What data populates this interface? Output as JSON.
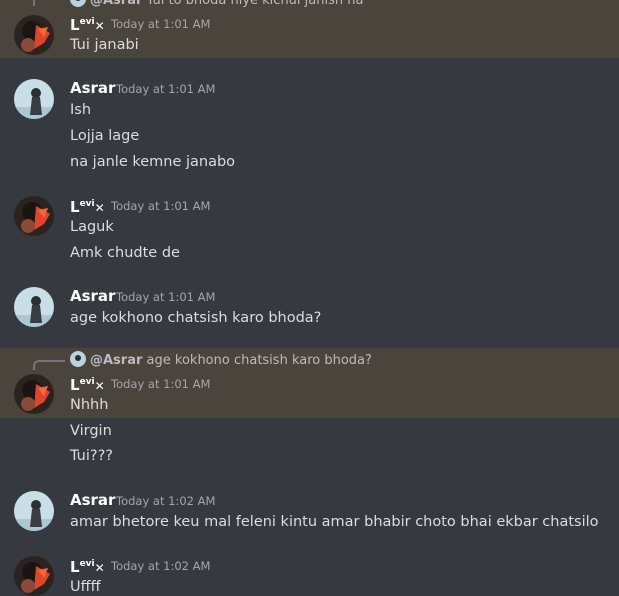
{
  "messages": [
    {
      "reply": {
        "mention": "@Asrar",
        "text": "Tui to bhoda niye kichui janish na"
      },
      "author_levi": {
        "l": "L",
        "evi": "evi",
        "x": "✕"
      },
      "timestamp": "Today at 1:01 AM",
      "lines": [
        "Tui janabi"
      ]
    },
    {
      "author": "Asrar",
      "timestamp": "Today at 1:01 AM",
      "lines": [
        "Ish",
        "Lojja lage",
        "na janle kemne janabo"
      ]
    },
    {
      "author_levi": {
        "l": "L",
        "evi": "evi",
        "x": "✕"
      },
      "timestamp": "Today at 1:01 AM",
      "lines": [
        "Laguk",
        "Amk chudte de"
      ]
    },
    {
      "author": "Asrar",
      "timestamp": "Today at 1:01 AM",
      "lines": [
        "age kokhono chatsish karo bhoda?"
      ]
    },
    {
      "reply": {
        "mention": "@Asrar",
        "text": "age kokhono chatsish karo bhoda?"
      },
      "author_levi": {
        "l": "L",
        "evi": "evi",
        "x": "✕"
      },
      "timestamp": "Today at 1:01 AM",
      "lines": [
        "Nhhh",
        "Virgin",
        "Tui???"
      ]
    },
    {
      "author": "Asrar",
      "timestamp": "Today at 1:02 AM",
      "lines": [
        "amar bhetore keu mal feleni kintu amar bhabir choto bhai ekbar chatsilo"
      ]
    },
    {
      "author_levi": {
        "l": "L",
        "evi": "evi",
        "x": "✕"
      },
      "timestamp": "Today at 1:02 AM",
      "lines": [
        "Uffff"
      ]
    }
  ],
  "colors": {
    "background": "#36393f",
    "highlight": "#49443c",
    "author": "#ffffff",
    "timestamp": "#a3a6aa",
    "text": "#dcddde"
  }
}
